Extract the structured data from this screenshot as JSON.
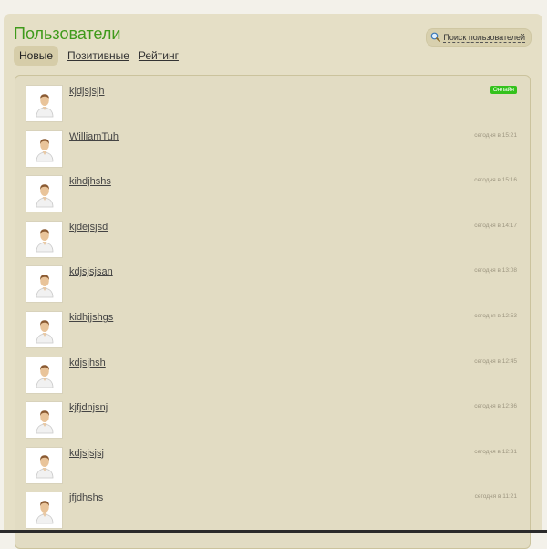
{
  "header": {
    "title": "Пользователи",
    "search_label": "Поиск пользователей"
  },
  "tabs": [
    {
      "label": "Новые",
      "active": true
    },
    {
      "label": "Позитивные",
      "active": false
    },
    {
      "label": "Рейтинг",
      "active": false
    }
  ],
  "users": [
    {
      "name": "kjdjsjsjh",
      "status": "Онлайн",
      "online": true
    },
    {
      "name": "WilliamTuh",
      "status": "сегодня в 15:21",
      "online": false
    },
    {
      "name": "kihdjhshs",
      "status": "сегодня в 15:16",
      "online": false
    },
    {
      "name": "kjdejsjsd",
      "status": "сегодня в 14:17",
      "online": false
    },
    {
      "name": "kdjsjsjsan",
      "status": "сегодня в 13:08",
      "online": false
    },
    {
      "name": "kidhjjshgs",
      "status": "сегодня в 12:53",
      "online": false
    },
    {
      "name": "kdjsjhsh",
      "status": "сегодня в 12:45",
      "online": false
    },
    {
      "name": "kjfjdnjsnj",
      "status": "сегодня в 12:36",
      "online": false
    },
    {
      "name": "kdjsjsjsj",
      "status": "сегодня в 12:31",
      "online": false
    },
    {
      "name": "jfjdhshs",
      "status": "сегодня в 11:21",
      "online": false
    }
  ],
  "colors": {
    "title": "#3f9a1b",
    "online_badge": "#34c21c",
    "panel": "#e5dfc6"
  }
}
